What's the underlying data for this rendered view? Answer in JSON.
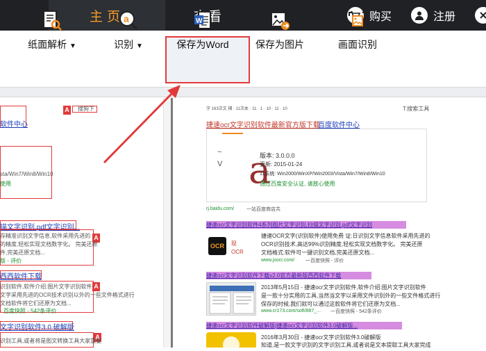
{
  "topbar": {
    "tabs": [
      {
        "label": "主页"
      },
      {
        "label": "查看"
      }
    ],
    "buy_label": "购买",
    "register_label": "注册",
    "colors": {
      "bar": "#1f2125",
      "active_tab_text": "#f39b2a"
    }
  },
  "ribbon": {
    "buttons": [
      {
        "label": "纸面解析",
        "arrow": "▼",
        "icon": "doc-search-icon"
      },
      {
        "label": "识别",
        "arrow": "▼",
        "icon": "recognize-icon"
      },
      {
        "label": "保存为Word",
        "icon": "word-icon"
      },
      {
        "label": "保存为图片",
        "icon": "image-export-icon"
      },
      {
        "label": "画面识别",
        "icon": "screen-capture-icon"
      }
    ]
  },
  "left": {
    "marker": "A",
    "top_snippet": "搜狗下",
    "title1": "软件中心",
    "box_line1": "sta/Win7/Win8/Win10",
    "box_line2": "使用",
    "result1_title": "描文字识别,pdf文字识别...",
    "result1_lines": [
      "存精准识别文字信息,软件采用先进的",
      "的精度,轻松实现文档数字化。 完美还原",
      "件,完美还原文档..."
    ],
    "result1_meta": "版 - 评价",
    "result2_title": "西西软件下载",
    "result2_lines": [
      "识别软件,软件介绍:图片文字识别软件",
      "文字采用先进的OCR技术识别以外的一些文件格式进行",
      "文档软件将它们还原为文档..."
    ],
    "result2_meta": "- 百度快照 - 542条评价",
    "result3_title": "文字识别软件3.0 破解版",
    "result3_line": "识别工具,或者将是图文转换工具大家重要"
  },
  "right": {
    "top_small": "字 163次文 捕 · 11次本 · 11 · 1 · 10 · 11 · 10",
    "top_right": "T:搜索工具",
    "title_link1": "捷速ocr文字识别软件最新官方版下载",
    "title_link2": "百度软件中心",
    "info_version": "版本: 3.0.0.0",
    "info_update": "更新: 2015-01-24",
    "info_system": "11系统: Win2000/WinXP/Win2003/Vista/Win7/Win8/Win10",
    "info_safe": "通过百度安全认证, 请放心使用",
    "watermark": "a",
    "tilde": "~",
    "vmark": "V",
    "url1": "rj.baidu.com/",
    "url1_tail": "一站百度商店共",
    "r1_title": "捷速ocr文字识别软件4系列图片文字识别,扫描文字识别,pdf文字识别",
    "r1_lines": [
      "捷速OCR文字(识别软件)使用免费 证:日识别文字信息软件采用先进的",
      "OCR识别技术,高达99%识别精度,轻松实现文档数字化。 完美还原",
      "文档格式:软件可一键识别文档,完美还原文档..."
    ],
    "r1_url": "www.jsocr.com/",
    "r1_url_tail": "一百度快照 - 评价",
    "r2_title": "捷速ocr文字识别软件下载v2.0官方最新版西西软件下载",
    "r2_lines": [
      "2013年5月15日 - 捷速ocr文字识别软件,软件介绍:图片文字识别软件",
      "是一款十分实用的工具,当然当文字以采用文件识别外的一些文件格式进行",
      "保存的时候,我们就可以通过这款软件将它们还原为文档..."
    ],
    "r2_url": "www.cr173.com/soft/887_...",
    "r2_url_tail": "一百度快照 - 542条评价",
    "r3_title": "捷速ocr文字识别软件破解版|捷速ocr文字识别软件3.0破解版...",
    "r3_lines": [
      "2016年3月30日 - 捷速ocr文字识别软件3.0破解版",
      "知道,是一款文字识别的文字识别工具,或者说是文本提取工具大家完成"
    ],
    "ocr_logo": "OCR",
    "r1_badge1": "现",
    "r1_badge2": "OCR"
  }
}
